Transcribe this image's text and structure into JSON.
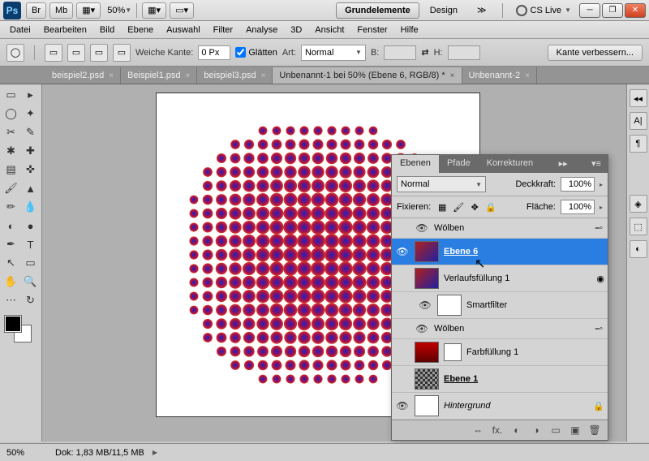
{
  "title": {
    "logo": "Ps",
    "br": "Br",
    "mb": "Mb",
    "zoom": "50%",
    "workspace_active": "Grundelemente",
    "workspace_other": "Design",
    "cslive": "CS Live",
    "chevrons": "≫"
  },
  "menu": {
    "items": [
      "Datei",
      "Bearbeiten",
      "Bild",
      "Ebene",
      "Auswahl",
      "Filter",
      "Analyse",
      "3D",
      "Ansicht",
      "Fenster",
      "Hilfe"
    ]
  },
  "options": {
    "weiche_kante": "Weiche Kante:",
    "weiche_kante_val": "0 Px",
    "glaetten": "Glätten",
    "art": "Art:",
    "art_val": "Normal",
    "b_label": "B:",
    "h_label": "H:",
    "improve_edge": "Kante verbessern..."
  },
  "tabs": [
    {
      "label": "beispiel2.psd",
      "active": false
    },
    {
      "label": "Beispiel1.psd",
      "active": false
    },
    {
      "label": "beispiel3.psd",
      "active": false
    },
    {
      "label": "Unbenannt-1 bei 50% (Ebene 6, RGB/8) *",
      "active": true
    },
    {
      "label": "Unbenannt-2",
      "active": false
    }
  ],
  "layers_panel": {
    "tabs": {
      "ebenen": "Ebenen",
      "pfade": "Pfade",
      "korrekturen": "Korrekturen"
    },
    "blend": "Normal",
    "opacity_label": "Deckkraft:",
    "opacity": "100%",
    "fix_label": "Fixieren:",
    "fill_label": "Fläche:",
    "fill": "100%",
    "group_woelben": "Wölben",
    "layers": [
      {
        "name": "Ebene 6",
        "selected": true,
        "bold": true
      },
      {
        "name": "Verlaufsfüllung 1"
      },
      {
        "name": "Smartfilter",
        "indent": true
      },
      {
        "name": "Wölben",
        "indent": true,
        "group": true
      },
      {
        "name": "Farbfüllung 1"
      },
      {
        "name": "Ebene 1",
        "bold": true
      },
      {
        "name": "Hintergrund",
        "italic": true,
        "locked": true
      }
    ]
  },
  "status": {
    "zoom": "50%",
    "doc": "Dok: 1,83 MB/11,5 MB"
  },
  "right_dock": [
    "A|",
    "¶"
  ]
}
